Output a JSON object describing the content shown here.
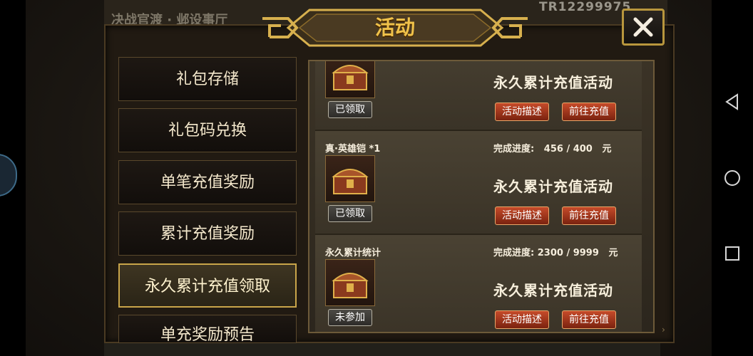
{
  "background": {
    "server_id": "TR12299975",
    "hall_text": "决战官渡 · 邺设事厅"
  },
  "dialog": {
    "title": "活动",
    "close_icon": "close-icon"
  },
  "sidebar": {
    "items": [
      {
        "label": "礼包存储",
        "active": false
      },
      {
        "label": "礼包码兑换",
        "active": false
      },
      {
        "label": "单笔充值奖励",
        "active": false
      },
      {
        "label": "累计充值奖励",
        "active": false
      },
      {
        "label": "永久累计充值领取",
        "active": true
      },
      {
        "label": "单充奖励预告",
        "active": false
      }
    ]
  },
  "activities": [
    {
      "title": "",
      "progress_label": "",
      "progress_value": "",
      "unit": "",
      "name": "永久累计充值活动",
      "status": "已领取",
      "desc_button": "活动描述",
      "go_button": "前往充值"
    },
    {
      "title": "真·英雄铠 *1",
      "progress_label": "完成进度:",
      "progress_value": "456 / 400",
      "unit": "元",
      "name": "永久累计充值活动",
      "status": "已领取",
      "desc_button": "活动描述",
      "go_button": "前往充值"
    },
    {
      "title": "永久累计统计",
      "progress_label": "完成进度:",
      "progress_value": "2300 / 9999",
      "unit": "元",
      "name": "永久累计充值活动",
      "status": "未参加",
      "desc_button": "活动描述",
      "go_button": "前往充值"
    }
  ],
  "colors": {
    "accent_gold": "#f0c24a",
    "button_red": "#c64b2a",
    "panel_dark": "#211a12"
  }
}
